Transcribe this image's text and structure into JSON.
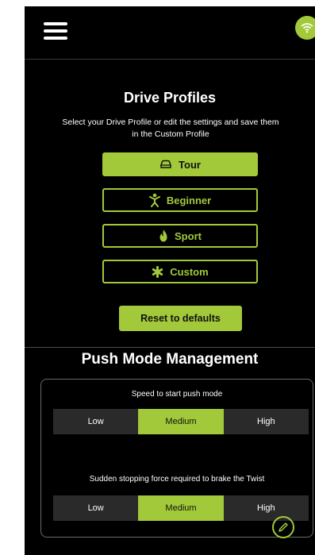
{
  "header": {
    "menu_icon": "hamburger-menu-icon",
    "status_icon": "wifi-icon",
    "accent_color": "#a2c93a"
  },
  "drive_profiles": {
    "title": "Drive Profiles",
    "subtitle_line1": "Select your Drive Profile or edit the settings and save them",
    "subtitle_line2": "in the Custom Profile",
    "options": [
      {
        "label": "Tour",
        "icon": "car-icon",
        "selected": true
      },
      {
        "label": "Beginner",
        "icon": "person-icon",
        "selected": false
      },
      {
        "label": "Sport",
        "icon": "flame-icon",
        "selected": false
      },
      {
        "label": "Custom",
        "icon": "asterisk-icon",
        "selected": false
      }
    ],
    "reset_label": "Reset to defaults"
  },
  "push_mode": {
    "title": "Push Mode Management",
    "speed_label": "Speed to start push mode",
    "speed_options": [
      "Low",
      "Medium",
      "High"
    ],
    "speed_selected": "Medium",
    "brake_label": "Sudden stopping force required to brake the Twist",
    "brake_options": [
      "Low",
      "Medium",
      "High"
    ],
    "brake_selected": "Medium"
  },
  "floating_action_icon": "pencil-icon"
}
